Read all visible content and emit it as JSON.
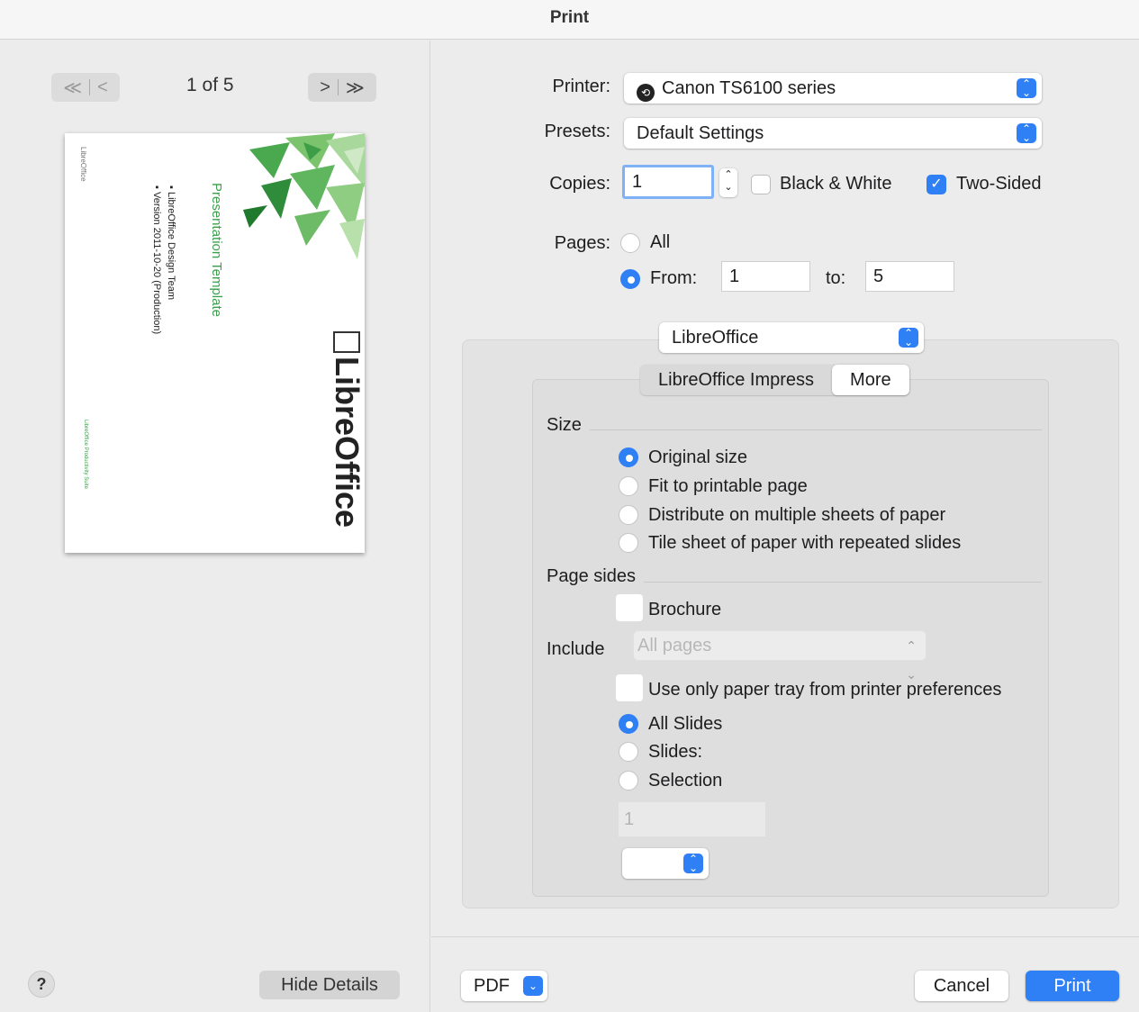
{
  "window": {
    "title": "Print"
  },
  "preview_nav": {
    "first_prev_glyph": "≪ | <",
    "page_counter": "1 of 5",
    "next_last_glyph": "> | ≫"
  },
  "preview_page": {
    "vertical_side_text": "LibreOffice",
    "title": "Presentation Template",
    "bullet_1": "LibreOffice Design Team",
    "bullet_2": "Version 2011-10-20 (Production)",
    "logo_text": "LibreOffice",
    "footer_text": "LibreOffice Productivity Suite"
  },
  "left_footer": {
    "help_label": "?",
    "hide_details_label": "Hide Details"
  },
  "printer": {
    "label": "Printer:",
    "value": "Canon TS6100 series"
  },
  "presets": {
    "label": "Presets:",
    "value": "Default Settings"
  },
  "copies": {
    "label": "Copies:",
    "value": "1",
    "black_white_label": "Black & White",
    "black_white_checked": false,
    "two_sided_label": "Two-Sided",
    "two_sided_checked": true
  },
  "pages": {
    "label": "Pages:",
    "all_label": "All",
    "from_label": "From:",
    "from_value": "1",
    "to_label": "to:",
    "to_value": "5",
    "selected": "from"
  },
  "app_popup": {
    "value": "LibreOffice"
  },
  "tabs": {
    "impress_label": "LibreOffice Impress",
    "more_label": "More",
    "active": "More"
  },
  "size": {
    "title": "Size",
    "options": [
      "Original size",
      "Fit to printable page",
      "Distribute on multiple sheets of paper",
      "Tile sheet of paper with repeated slides"
    ],
    "selected": "Original size"
  },
  "page_sides": {
    "title": "Page sides",
    "brochure_label": "Brochure",
    "include_label": "Include",
    "include_value": "All pages",
    "paper_tray_label": "Use only paper tray from printer preferences"
  },
  "slides": {
    "options": [
      "All Slides",
      "Slides:",
      "Selection"
    ],
    "selected": "All Slides",
    "slides_field_value": "1"
  },
  "bottom": {
    "pdf_label": "PDF",
    "cancel_label": "Cancel",
    "print_label": "Print"
  },
  "colors": {
    "accent": "#2f7ff5",
    "pane_bg": "#ececec",
    "preview_green": "#3aa14a"
  }
}
